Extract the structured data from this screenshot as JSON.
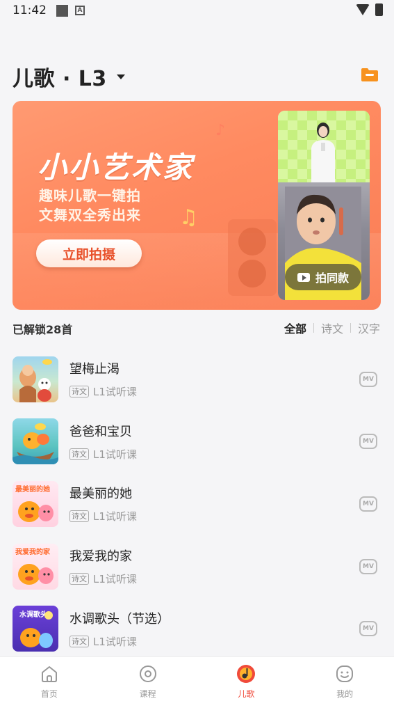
{
  "status_bar": {
    "time": "11:42"
  },
  "header": {
    "title": "儿歌 · L3"
  },
  "banner": {
    "title": "小小艺术家",
    "subtitle_line1": "趣味儿歌一键拍",
    "subtitle_line2": "文舞双全秀出来",
    "cta_label": "立即拍摄",
    "same_label": "拍同款"
  },
  "filter": {
    "unlocked_label": "已解锁28首",
    "tabs": [
      {
        "label": "全部",
        "active": true
      },
      {
        "label": "诗文",
        "active": false
      },
      {
        "label": "汉字",
        "active": false
      }
    ]
  },
  "songs": [
    {
      "title": "望梅止渴",
      "tag": "诗文",
      "lesson": "L1试听课",
      "mv": "MV"
    },
    {
      "title": "爸爸和宝贝",
      "tag": "诗文",
      "lesson": "L1试听课",
      "mv": "MV"
    },
    {
      "title": "最美丽的她",
      "tag": "诗文",
      "lesson": "L1试听课",
      "mv": "MV"
    },
    {
      "title": "我爱我的家",
      "tag": "诗文",
      "lesson": "L1试听课",
      "mv": "MV"
    },
    {
      "title": "水调歌头（节选）",
      "tag": "诗文",
      "lesson": "L1试听课",
      "mv": "MV"
    }
  ],
  "thumb_texts": [
    "最美丽的她",
    "我爱我的家",
    "水调歌头"
  ],
  "nav": [
    {
      "label": "首页",
      "icon": "home-icon",
      "active": false
    },
    {
      "label": "课程",
      "icon": "play-circle-icon",
      "active": false
    },
    {
      "label": "儿歌",
      "icon": "music-note-icon",
      "active": true
    },
    {
      "label": "我的",
      "icon": "smile-face-icon",
      "active": false
    }
  ],
  "colors": {
    "accent": "#f04a3a",
    "banner": "#ff8a60",
    "folder": "#f7921e"
  }
}
